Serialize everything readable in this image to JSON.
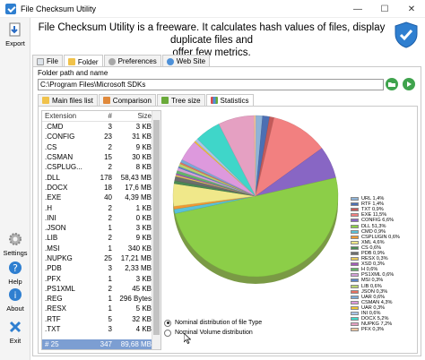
{
  "window": {
    "title": "File Checksum Utility"
  },
  "sidebar": {
    "export": "Export",
    "settings": "Settings",
    "help": "Help",
    "about": "About",
    "exit": "Exit"
  },
  "header": {
    "line1": "File Checksum Utility is a freeware. It calculates hash values of files, display duplicate files and",
    "line2": "offer few metrics."
  },
  "top_tabs": [
    "File",
    "Folder",
    "Preferences",
    "Web Site"
  ],
  "folder": {
    "label": "Folder path and name",
    "path": "C:\\Program Files\\Microsoft SDKs"
  },
  "sub_tabs": [
    "Main files list",
    "Comparison",
    "Tree size",
    "Statistics"
  ],
  "table": {
    "columns": [
      "Extension",
      "#",
      "Size"
    ],
    "rows": [
      [
        ".CMD",
        "3",
        "3 KB"
      ],
      [
        ".CONFIG",
        "23",
        "31 KB"
      ],
      [
        ".CS",
        "2",
        "9 KB"
      ],
      [
        ".CSMAN",
        "15",
        "30 KB"
      ],
      [
        ".CSPLUG...",
        "2",
        "8 KB"
      ],
      [
        ".DLL",
        "178",
        "58,43 MB"
      ],
      [
        ".DOCX",
        "18",
        "17,6 MB"
      ],
      [
        ".EXE",
        "40",
        "4,39 MB"
      ],
      [
        ".H",
        "2",
        "1 KB"
      ],
      [
        ".INI",
        "2",
        "0 KB"
      ],
      [
        ".JSON",
        "1",
        "3 KB"
      ],
      [
        ".LIB",
        "2",
        "9 KB"
      ],
      [
        ".MSI",
        "1",
        "340 KB"
      ],
      [
        ".NUPKG",
        "25",
        "17,21 MB"
      ],
      [
        ".PDB",
        "3",
        "2,33 MB"
      ],
      [
        ".PFX",
        "1",
        "3 KB"
      ],
      [
        ".PS1XML",
        "2",
        "45 KB"
      ],
      [
        ".REG",
        "1",
        "296 Bytes"
      ],
      [
        ".RESX",
        "1",
        "5 KB"
      ],
      [
        ".RTF",
        "5",
        "32 KB"
      ],
      [
        ".TXT",
        "3",
        "4 KB"
      ]
    ],
    "total": [
      "# 25",
      "347",
      "89,68 MB"
    ]
  },
  "chart_data": {
    "type": "pie",
    "slices": [
      {
        "label": "URL 1,4%",
        "value": 1.4,
        "color": "#8fb4d8"
      },
      {
        "label": "RTF 1,4%",
        "value": 1.4,
        "color": "#4c6fb3"
      },
      {
        "label": "TXT 0,9%",
        "value": 0.9,
        "color": "#c35a5a"
      },
      {
        "label": "EXE 11,5%",
        "value": 11.5,
        "color": "#f28080"
      },
      {
        "label": "CONFIG 6,6%",
        "value": 6.6,
        "color": "#8866c4"
      },
      {
        "label": "DLL 51,3%",
        "value": 51.3,
        "color": "#8cce48"
      },
      {
        "label": "CMD 0,9%",
        "value": 0.9,
        "color": "#59c2d9"
      },
      {
        "label": "CSPLUGIN 0,6%",
        "value": 0.6,
        "color": "#ef9933"
      },
      {
        "label": "XML 4,6%",
        "value": 4.6,
        "color": "#f0e88a"
      },
      {
        "label": "CS 0,6%",
        "value": 0.6,
        "color": "#4b8a55"
      },
      {
        "label": "PDB 0,9%",
        "value": 0.9,
        "color": "#6d6d6d"
      },
      {
        "label": "RESX 0,3%",
        "value": 0.3,
        "color": "#e6c85b"
      },
      {
        "label": "XSD 0,3%",
        "value": 0.3,
        "color": "#a15bb8"
      },
      {
        "label": "H 0,6%",
        "value": 0.6,
        "color": "#62b56a"
      },
      {
        "label": "PS1XML 0,6%",
        "value": 0.6,
        "color": "#d4a0d8"
      },
      {
        "label": "MSI 0,3%",
        "value": 0.3,
        "color": "#5a84c8"
      },
      {
        "label": "LIB 0,6%",
        "value": 0.6,
        "color": "#b8d370"
      },
      {
        "label": "JSON 0,3%",
        "value": 0.3,
        "color": "#e97060"
      },
      {
        "label": "UAR 0,6%",
        "value": 0.6,
        "color": "#79a9d8"
      },
      {
        "label": "CSMAN 4,3%",
        "value": 4.3,
        "color": "#dd99dd"
      },
      {
        "label": "UAR 0,3%",
        "value": 0.3,
        "color": "#f1c232"
      },
      {
        "label": "INI 0,6%",
        "value": 0.6,
        "color": "#aac4e6"
      },
      {
        "label": "DOCX 5,2%",
        "value": 5.2,
        "color": "#3fd6c9"
      },
      {
        "label": "NUPKG 7,2%",
        "value": 7.2,
        "color": "#e5a0c2"
      },
      {
        "label": "PFX 0,3%",
        "value": 0.3,
        "color": "#f5c7a0"
      }
    ]
  },
  "radio": {
    "opt1": "Nominal distribution of file Type",
    "opt2": "Nominal Volume distribution"
  }
}
